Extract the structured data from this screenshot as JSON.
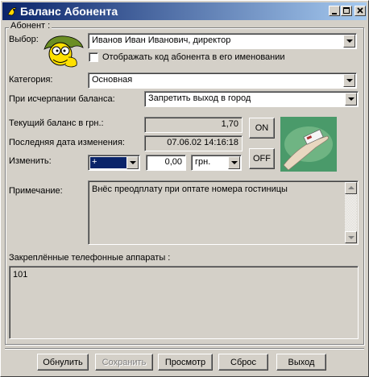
{
  "window": {
    "title": "Баланс Абонента",
    "group_label": "Абонент :"
  },
  "subscriber": {
    "choice_label": "Выбор:",
    "choice_value": "Иванов Иван Иванович, директор",
    "show_code_label": "Отображать код абонента в его именовании",
    "show_code_checked": false
  },
  "category": {
    "label": "Категория:",
    "value": "Основная"
  },
  "balance_exhausted": {
    "label": "При исчерпании баланса:",
    "value": "Запретить выход в город"
  },
  "balance": {
    "current_label": "Текущий баланс в грн.:",
    "current_value": "1,70",
    "last_change_label": "Последняя дата изменения:",
    "last_change_value": "07.06.02 14:16:18",
    "change_label": "Изменить:",
    "sign_value": "+",
    "amount_value": "0,00",
    "currency_value": "грн."
  },
  "switch": {
    "on_label": "ON",
    "off_label": "OFF"
  },
  "note": {
    "label": "Примечание:",
    "value": "Внёс преодплату при оптате номера гостиницы"
  },
  "phones": {
    "label": "Закреплённые телефонные аппараты :",
    "items": [
      "101"
    ]
  },
  "buttons": {
    "reset": "Обнулить",
    "save": "Сохранить",
    "view": "Просмотр",
    "clear": "Сброс",
    "exit": "Выход"
  },
  "colors": {
    "title_start": "#0a246a",
    "title_end": "#a6caf0",
    "face": "#d4d0c8",
    "selection": "#0a246a",
    "card_bg": "#4a9a6a"
  },
  "icons": {
    "avatar": "cartoon-face-icon",
    "card": "card-in-hand-icon"
  }
}
